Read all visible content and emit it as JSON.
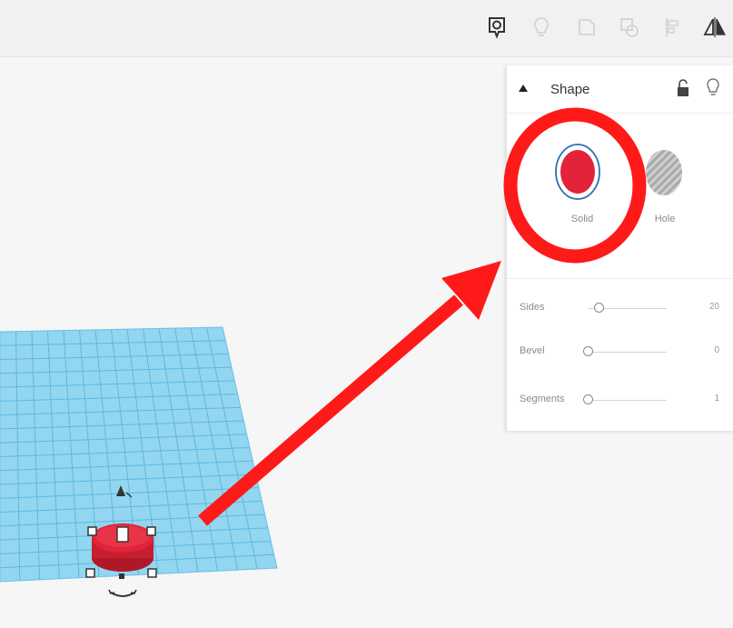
{
  "toolbar": {
    "icons": [
      "notes-icon",
      "lightbulb-icon",
      "group-icon",
      "ungroup-icon",
      "align-icon",
      "mirror-icon"
    ]
  },
  "inspector": {
    "title": "Shape",
    "modes": [
      {
        "label": "Solid",
        "color": "#e2233a",
        "selected": true
      },
      {
        "label": "Hole",
        "color": "#b5b5b5",
        "selected": false
      }
    ],
    "params": [
      {
        "label": "Sides",
        "value": "20",
        "position": 0.2
      },
      {
        "label": "Bevel",
        "value": "0",
        "position": 0.0
      },
      {
        "label": "Segments",
        "value": "1",
        "position": 0.0
      }
    ]
  },
  "colors": {
    "accent_red": "#ff1a1a",
    "solid_red": "#e2233a",
    "workplane_blue": "#8fd3ee",
    "grid_line": "#5bb7e0"
  }
}
